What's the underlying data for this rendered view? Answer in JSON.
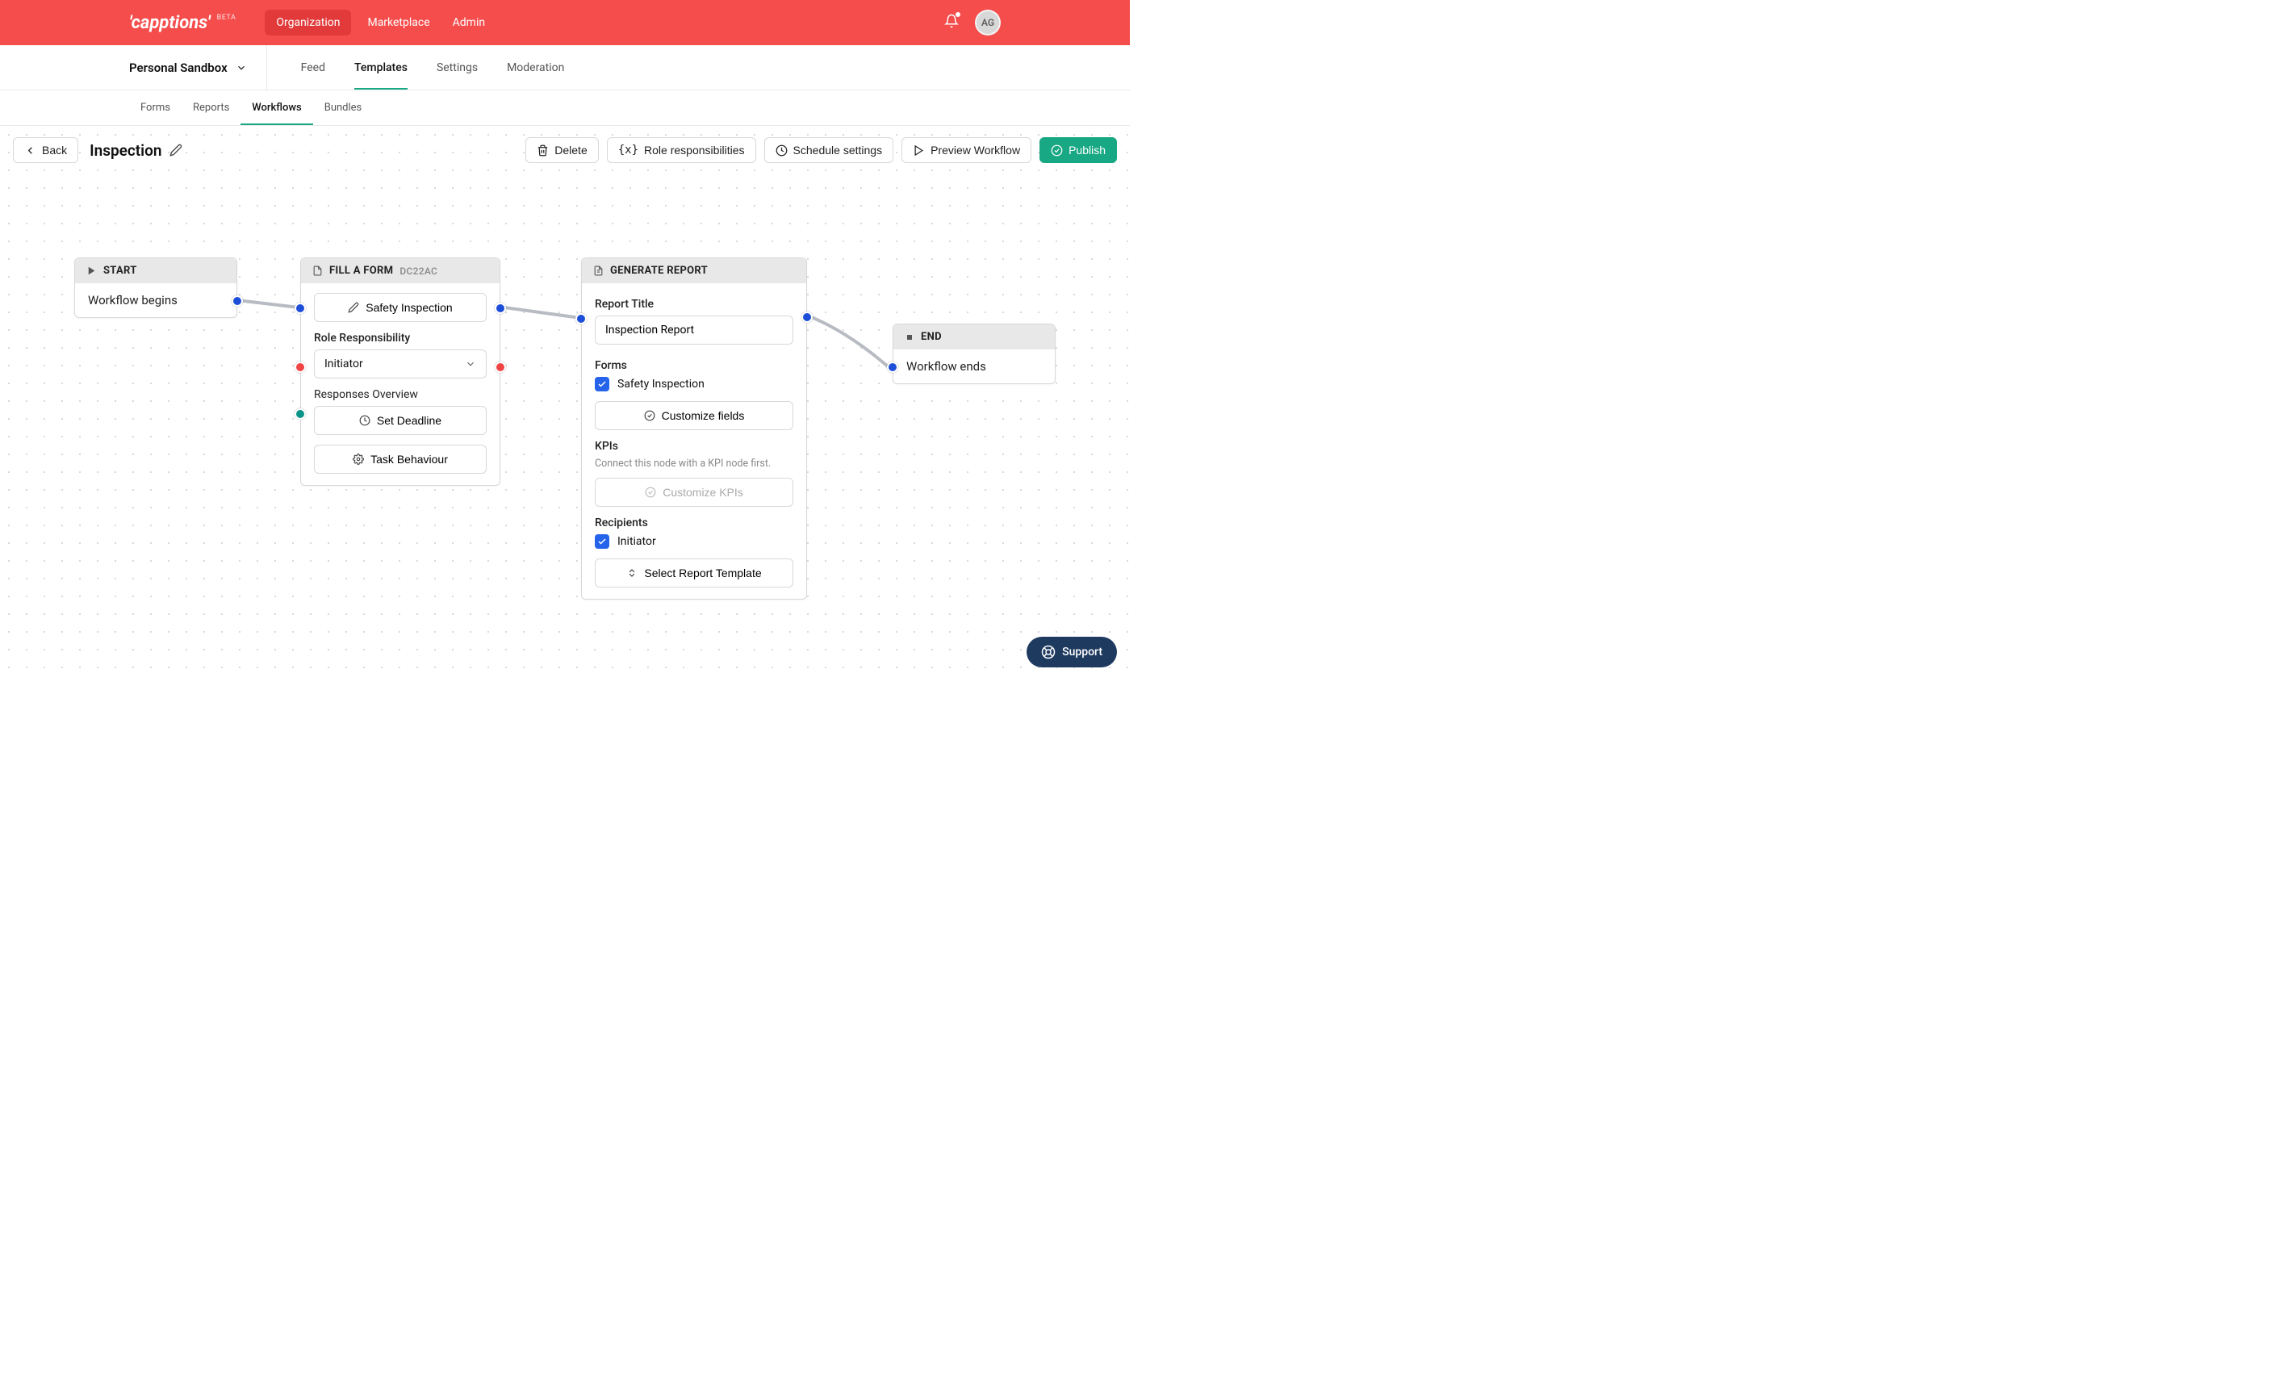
{
  "header": {
    "logo": "'capptions'",
    "beta": "BETA",
    "nav": {
      "org": "Organization",
      "marketplace": "Marketplace",
      "admin": "Admin"
    },
    "avatar": "AG"
  },
  "subnav": {
    "workspace": "Personal Sandbox",
    "tabs": {
      "feed": "Feed",
      "templates": "Templates",
      "settings": "Settings",
      "moderation": "Moderation"
    }
  },
  "subnav2": {
    "forms": "Forms",
    "reports": "Reports",
    "workflows": "Workflows",
    "bundles": "Bundles"
  },
  "toolbar": {
    "back": "Back",
    "title": "Inspection",
    "delete": "Delete",
    "role_resp": "Role responsibilities",
    "schedule": "Schedule settings",
    "preview": "Preview Workflow",
    "publish": "Publish"
  },
  "nodes": {
    "start": {
      "title": "START",
      "body": "Workflow begins"
    },
    "form": {
      "title": "FILL A FORM",
      "code": "DC22AC",
      "select_form": "Safety Inspection",
      "role_label": "Role Responsibility",
      "role_value": "Initiator",
      "overview": "Responses Overview",
      "deadline": "Set Deadline",
      "behaviour": "Task Behaviour"
    },
    "report": {
      "title": "GENERATE REPORT",
      "title_label": "Report Title",
      "title_value": "Inspection Report",
      "forms_label": "Forms",
      "form_item": "Safety Inspection",
      "customize": "Customize fields",
      "kpis_label": "KPIs",
      "kpis_hint": "Connect this node with a KPI node first.",
      "customize_kpis": "Customize KPIs",
      "recipients_label": "Recipients",
      "recipient_item": "Initiator",
      "select_template": "Select Report Template"
    },
    "end": {
      "title": "END",
      "body": "Workflow ends"
    }
  },
  "support": "Support"
}
